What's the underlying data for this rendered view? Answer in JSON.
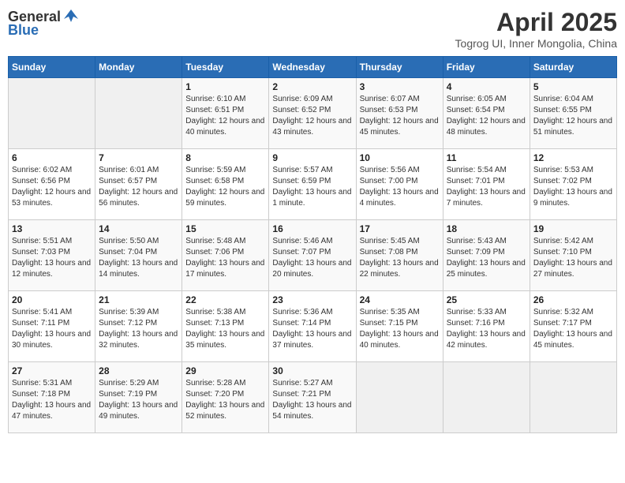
{
  "logo": {
    "general": "General",
    "blue": "Blue"
  },
  "title": {
    "month_year": "April 2025",
    "location": "Togrog UI, Inner Mongolia, China"
  },
  "days_of_week": [
    "Sunday",
    "Monday",
    "Tuesday",
    "Wednesday",
    "Thursday",
    "Friday",
    "Saturday"
  ],
  "weeks": [
    [
      {
        "day": "",
        "sunrise": "",
        "sunset": "",
        "daylight": ""
      },
      {
        "day": "",
        "sunrise": "",
        "sunset": "",
        "daylight": ""
      },
      {
        "day": "1",
        "sunrise": "Sunrise: 6:10 AM",
        "sunset": "Sunset: 6:51 PM",
        "daylight": "Daylight: 12 hours and 40 minutes."
      },
      {
        "day": "2",
        "sunrise": "Sunrise: 6:09 AM",
        "sunset": "Sunset: 6:52 PM",
        "daylight": "Daylight: 12 hours and 43 minutes."
      },
      {
        "day": "3",
        "sunrise": "Sunrise: 6:07 AM",
        "sunset": "Sunset: 6:53 PM",
        "daylight": "Daylight: 12 hours and 45 minutes."
      },
      {
        "day": "4",
        "sunrise": "Sunrise: 6:05 AM",
        "sunset": "Sunset: 6:54 PM",
        "daylight": "Daylight: 12 hours and 48 minutes."
      },
      {
        "day": "5",
        "sunrise": "Sunrise: 6:04 AM",
        "sunset": "Sunset: 6:55 PM",
        "daylight": "Daylight: 12 hours and 51 minutes."
      }
    ],
    [
      {
        "day": "6",
        "sunrise": "Sunrise: 6:02 AM",
        "sunset": "Sunset: 6:56 PM",
        "daylight": "Daylight: 12 hours and 53 minutes."
      },
      {
        "day": "7",
        "sunrise": "Sunrise: 6:01 AM",
        "sunset": "Sunset: 6:57 PM",
        "daylight": "Daylight: 12 hours and 56 minutes."
      },
      {
        "day": "8",
        "sunrise": "Sunrise: 5:59 AM",
        "sunset": "Sunset: 6:58 PM",
        "daylight": "Daylight: 12 hours and 59 minutes."
      },
      {
        "day": "9",
        "sunrise": "Sunrise: 5:57 AM",
        "sunset": "Sunset: 6:59 PM",
        "daylight": "Daylight: 13 hours and 1 minute."
      },
      {
        "day": "10",
        "sunrise": "Sunrise: 5:56 AM",
        "sunset": "Sunset: 7:00 PM",
        "daylight": "Daylight: 13 hours and 4 minutes."
      },
      {
        "day": "11",
        "sunrise": "Sunrise: 5:54 AM",
        "sunset": "Sunset: 7:01 PM",
        "daylight": "Daylight: 13 hours and 7 minutes."
      },
      {
        "day": "12",
        "sunrise": "Sunrise: 5:53 AM",
        "sunset": "Sunset: 7:02 PM",
        "daylight": "Daylight: 13 hours and 9 minutes."
      }
    ],
    [
      {
        "day": "13",
        "sunrise": "Sunrise: 5:51 AM",
        "sunset": "Sunset: 7:03 PM",
        "daylight": "Daylight: 13 hours and 12 minutes."
      },
      {
        "day": "14",
        "sunrise": "Sunrise: 5:50 AM",
        "sunset": "Sunset: 7:04 PM",
        "daylight": "Daylight: 13 hours and 14 minutes."
      },
      {
        "day": "15",
        "sunrise": "Sunrise: 5:48 AM",
        "sunset": "Sunset: 7:06 PM",
        "daylight": "Daylight: 13 hours and 17 minutes."
      },
      {
        "day": "16",
        "sunrise": "Sunrise: 5:46 AM",
        "sunset": "Sunset: 7:07 PM",
        "daylight": "Daylight: 13 hours and 20 minutes."
      },
      {
        "day": "17",
        "sunrise": "Sunrise: 5:45 AM",
        "sunset": "Sunset: 7:08 PM",
        "daylight": "Daylight: 13 hours and 22 minutes."
      },
      {
        "day": "18",
        "sunrise": "Sunrise: 5:43 AM",
        "sunset": "Sunset: 7:09 PM",
        "daylight": "Daylight: 13 hours and 25 minutes."
      },
      {
        "day": "19",
        "sunrise": "Sunrise: 5:42 AM",
        "sunset": "Sunset: 7:10 PM",
        "daylight": "Daylight: 13 hours and 27 minutes."
      }
    ],
    [
      {
        "day": "20",
        "sunrise": "Sunrise: 5:41 AM",
        "sunset": "Sunset: 7:11 PM",
        "daylight": "Daylight: 13 hours and 30 minutes."
      },
      {
        "day": "21",
        "sunrise": "Sunrise: 5:39 AM",
        "sunset": "Sunset: 7:12 PM",
        "daylight": "Daylight: 13 hours and 32 minutes."
      },
      {
        "day": "22",
        "sunrise": "Sunrise: 5:38 AM",
        "sunset": "Sunset: 7:13 PM",
        "daylight": "Daylight: 13 hours and 35 minutes."
      },
      {
        "day": "23",
        "sunrise": "Sunrise: 5:36 AM",
        "sunset": "Sunset: 7:14 PM",
        "daylight": "Daylight: 13 hours and 37 minutes."
      },
      {
        "day": "24",
        "sunrise": "Sunrise: 5:35 AM",
        "sunset": "Sunset: 7:15 PM",
        "daylight": "Daylight: 13 hours and 40 minutes."
      },
      {
        "day": "25",
        "sunrise": "Sunrise: 5:33 AM",
        "sunset": "Sunset: 7:16 PM",
        "daylight": "Daylight: 13 hours and 42 minutes."
      },
      {
        "day": "26",
        "sunrise": "Sunrise: 5:32 AM",
        "sunset": "Sunset: 7:17 PM",
        "daylight": "Daylight: 13 hours and 45 minutes."
      }
    ],
    [
      {
        "day": "27",
        "sunrise": "Sunrise: 5:31 AM",
        "sunset": "Sunset: 7:18 PM",
        "daylight": "Daylight: 13 hours and 47 minutes."
      },
      {
        "day": "28",
        "sunrise": "Sunrise: 5:29 AM",
        "sunset": "Sunset: 7:19 PM",
        "daylight": "Daylight: 13 hours and 49 minutes."
      },
      {
        "day": "29",
        "sunrise": "Sunrise: 5:28 AM",
        "sunset": "Sunset: 7:20 PM",
        "daylight": "Daylight: 13 hours and 52 minutes."
      },
      {
        "day": "30",
        "sunrise": "Sunrise: 5:27 AM",
        "sunset": "Sunset: 7:21 PM",
        "daylight": "Daylight: 13 hours and 54 minutes."
      },
      {
        "day": "",
        "sunrise": "",
        "sunset": "",
        "daylight": ""
      },
      {
        "day": "",
        "sunrise": "",
        "sunset": "",
        "daylight": ""
      },
      {
        "day": "",
        "sunrise": "",
        "sunset": "",
        "daylight": ""
      }
    ]
  ]
}
